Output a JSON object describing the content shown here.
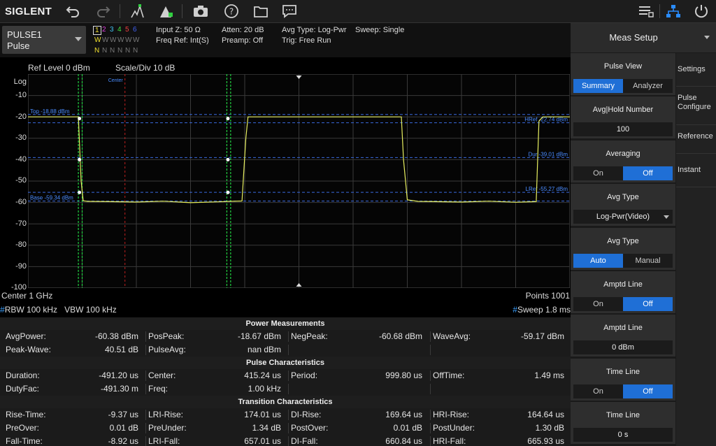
{
  "toolbar": {
    "brand": "SIGLENT",
    "icons": [
      "undo-icon",
      "redo-icon",
      "peak-marker-icon",
      "marker-icon",
      "camera-icon",
      "help-icon",
      "folder-icon",
      "message-icon",
      "menu-list-icon",
      "network-icon",
      "power-icon"
    ]
  },
  "trace_select": {
    "line1": "PULSE1",
    "line2": "Pulse"
  },
  "traces": {
    "numbers": [
      "1",
      "2",
      "3",
      "4",
      "5",
      "6"
    ],
    "modes": [
      "W",
      "W",
      "W",
      "W",
      "W",
      "W"
    ],
    "dets": [
      "N",
      "N",
      "N",
      "N",
      "N",
      "N"
    ],
    "colors": [
      "#f0e030",
      "#e040e0",
      "#40c0f0",
      "#40e040",
      "#f04040",
      "#4060f0"
    ]
  },
  "info": {
    "input_z": "Input Z: 50 Ω",
    "freq_ref": "Freq Ref: Int(S)",
    "atten": "Atten: 20 dB",
    "preamp": "Preamp: Off",
    "avg_type": "Avg Type: Log-Pwr",
    "trig": "Trig: Free Run",
    "sweep": "Sweep: Single"
  },
  "graph": {
    "ref_level": "Ref Level  0 dBm",
    "scale_div": "Scale/Div  10 dB",
    "scale_type": "Log",
    "y_ticks": [
      "-10",
      "-20",
      "-30",
      "-40",
      "-50",
      "-60",
      "-70",
      "-80",
      "-90",
      "-100"
    ],
    "center_label": "Center",
    "lines": {
      "top": "Top -18.88 dBm",
      "base": "Base -59.34 dBm",
      "href": "HRef -22.74 dBm",
      "dur": "Dur -39.01 dBm",
      "lref": "LRef -55.27 dBm"
    },
    "footer": {
      "center": "Center  1 GHz",
      "points": "Points  1001",
      "rbw": "RBW  100 kHz",
      "vbw": "VBW  100 kHz",
      "sweep": "Sweep  1.8 ms"
    },
    "colors": {
      "trace": "#e8f060",
      "marker": "#20d040",
      "center": "#c02020",
      "ref": "#3a6ae0",
      "grid": "#3a3a3a"
    }
  },
  "chart_data": {
    "type": "line",
    "title": "",
    "ylabel": "Log",
    "ylim": [
      -100,
      0
    ],
    "xlim": [
      0,
      100
    ],
    "series": [
      {
        "x": [
          0,
          9.3,
          9.8,
          10.2,
          11,
          15,
          20,
          25,
          30,
          35,
          39.5,
          40.2,
          40.6,
          41,
          50,
          60,
          68.9,
          69.3,
          70,
          72,
          75,
          80,
          85,
          90,
          93.8,
          94.3,
          95,
          100
        ],
        "y": [
          -20,
          -20,
          -50,
          -59.2,
          -59.5,
          -59.6,
          -59.8,
          -59.4,
          -60.1,
          -59.7,
          -59.3,
          -30,
          -20,
          -20,
          -20,
          -20,
          -20,
          -40,
          -58.8,
          -59.5,
          -59.6,
          -59.8,
          -59.4,
          -59.9,
          -59.6,
          -22,
          -20,
          -20
        ]
      }
    ],
    "ref_lines_dbm": {
      "top": -18.88,
      "href": -22.74,
      "dur": -39.01,
      "lref": -55.27,
      "base": -59.34
    }
  },
  "power": {
    "title": "Power Measurements",
    "rows": [
      [
        [
          "AvgPower:",
          "-60.38 dBm"
        ],
        [
          "PosPeak:",
          "-18.67 dBm"
        ],
        [
          "NegPeak:",
          "-60.68 dBm"
        ],
        [
          "WaveAvg:",
          "-59.17 dBm"
        ]
      ],
      [
        [
          "Peak-Wave:",
          "40.51 dB"
        ],
        [
          "PulseAvg:",
          "nan dBm"
        ],
        [
          "",
          ""
        ],
        [
          "",
          ""
        ]
      ]
    ]
  },
  "pulse": {
    "title": "Pulse Characteristics",
    "rows": [
      [
        [
          "Duration:",
          "-491.20 us"
        ],
        [
          "Center:",
          "415.24 us"
        ],
        [
          "Period:",
          "999.80 us"
        ],
        [
          "OffTime:",
          "1.49 ms"
        ]
      ],
      [
        [
          "DutyFac:",
          "-491.30 m"
        ],
        [
          "Freq:",
          "1.00 kHz"
        ],
        [
          "",
          ""
        ],
        [
          "",
          ""
        ]
      ]
    ]
  },
  "transition": {
    "title": "Transition Characteristics",
    "rows": [
      [
        [
          "Rise-Time:",
          "-9.37 us"
        ],
        [
          "LRI-Rise:",
          "174.01 us"
        ],
        [
          "DI-Rise:",
          "169.64 us"
        ],
        [
          "HRI-Rise:",
          "164.64 us"
        ]
      ],
      [
        [
          "PreOver:",
          "0.01 dB"
        ],
        [
          "PreUnder:",
          "1.34 dB"
        ],
        [
          "PostOver:",
          "0.01 dB"
        ],
        [
          "PostUnder:",
          "1.30 dB"
        ]
      ],
      [
        [
          "Fall-Time:",
          "-8.92 us"
        ],
        [
          "LRI-Fall:",
          "657.01 us"
        ],
        [
          "DI-Fall:",
          "660.84 us"
        ],
        [
          "HRI-Fall:",
          "665.93 us"
        ]
      ]
    ]
  },
  "panel": {
    "title": "Meas Setup",
    "tabs": [
      "Settings",
      "Pulse Configure",
      "Reference",
      "Instant"
    ],
    "blocks": [
      {
        "title": "Pulse View",
        "kind": "seg",
        "opts": [
          "Summary",
          "Analyzer"
        ],
        "sel": 0
      },
      {
        "title": "Avg|Hold Number",
        "kind": "val",
        "value": "100"
      },
      {
        "title": "Averaging",
        "kind": "seg",
        "opts": [
          "On",
          "Off"
        ],
        "sel": 1
      },
      {
        "title": "Avg Type",
        "kind": "drop",
        "value": "Log-Pwr(Video)"
      },
      {
        "title": "Avg Type",
        "kind": "seg",
        "opts": [
          "Auto",
          "Manual"
        ],
        "sel": 0
      },
      {
        "title": "Amptd Line",
        "kind": "seg",
        "opts": [
          "On",
          "Off"
        ],
        "sel": 1
      },
      {
        "title": "Amptd Line",
        "kind": "val",
        "value": "0 dBm"
      },
      {
        "title": "Time Line",
        "kind": "seg",
        "opts": [
          "On",
          "Off"
        ],
        "sel": 1
      },
      {
        "title": "Time Line",
        "kind": "val",
        "value": "0 s"
      }
    ]
  }
}
